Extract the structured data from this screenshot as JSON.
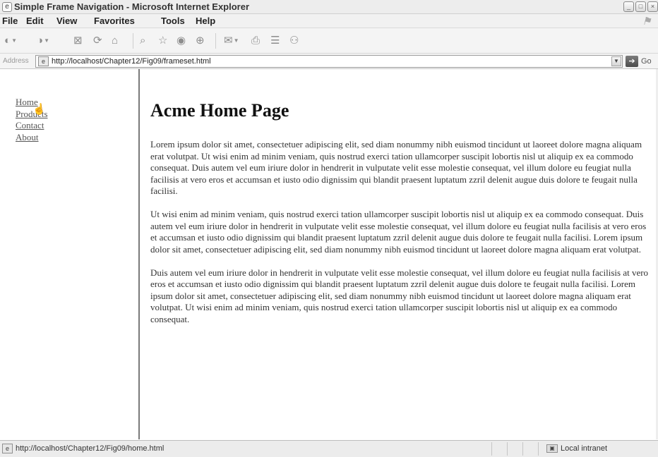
{
  "window": {
    "title": "Simple Frame Navigation - Microsoft Internet Explorer"
  },
  "menu": {
    "items": [
      "File",
      "Edit",
      "View",
      "Favorites",
      "Tools",
      "Help"
    ]
  },
  "toolbar": {
    "buttons": [
      "back-icon",
      "forward-icon",
      "stop-icon",
      "refresh-icon",
      "home-icon",
      "search-icon",
      "favorites-icon",
      "media-icon",
      "history-icon",
      "mail-icon",
      "print-icon",
      "edit-icon",
      "discuss-icon"
    ]
  },
  "address": {
    "label": "Address",
    "url": "http://localhost/Chapter12/Fig09/frameset.html",
    "go_label": "Go"
  },
  "nav": {
    "links": [
      "Home",
      "Products",
      "Contact",
      "About"
    ]
  },
  "content": {
    "title": "Acme Home Page",
    "paragraphs": [
      "Lorem ipsum dolor sit amet, consectetuer adipiscing elit, sed diam nonummy nibh euismod tincidunt ut laoreet dolore magna aliquam erat volutpat. Ut wisi enim ad minim veniam, quis nostrud exerci tation ullamcorper suscipit lobortis nisl ut aliquip ex ea commodo consequat. Duis autem vel eum iriure dolor in hendrerit in vulputate velit esse molestie consequat, vel illum dolore eu feugiat nulla facilisis at vero eros et accumsan et iusto odio dignissim qui blandit praesent luptatum zzril delenit augue duis dolore te feugait nulla facilisi.",
      "Ut wisi enim ad minim veniam, quis nostrud exerci tation ullamcorper suscipit lobortis nisl ut aliquip ex ea commodo consequat. Duis autem vel eum iriure dolor in hendrerit in vulputate velit esse molestie consequat, vel illum dolore eu feugiat nulla facilisis at vero eros et accumsan et iusto odio dignissim qui blandit praesent luptatum zzril delenit augue duis dolore te feugait nulla facilisi. Lorem ipsum dolor sit amet, consectetuer adipiscing elit, sed diam nonummy nibh euismod tincidunt ut laoreet dolore magna aliquam erat volutpat.",
      "Duis autem vel eum iriure dolor in hendrerit in vulputate velit esse molestie consequat, vel illum dolore eu feugiat nulla facilisis at vero eros et accumsan et iusto odio dignissim qui blandit praesent luptatum zzril delenit augue duis dolore te feugait nulla facilisi. Lorem ipsum dolor sit amet, consectetuer adipiscing elit, sed diam nonummy nibh euismod tincidunt ut laoreet dolore magna aliquam erat volutpat. Ut wisi enim ad minim veniam, quis nostrud exerci tation ullamcorper suscipit lobortis nisl ut aliquip ex ea commodo consequat."
    ]
  },
  "status": {
    "url": "http://localhost/Chapter12/Fig09/home.html",
    "zone": "Local intranet"
  }
}
